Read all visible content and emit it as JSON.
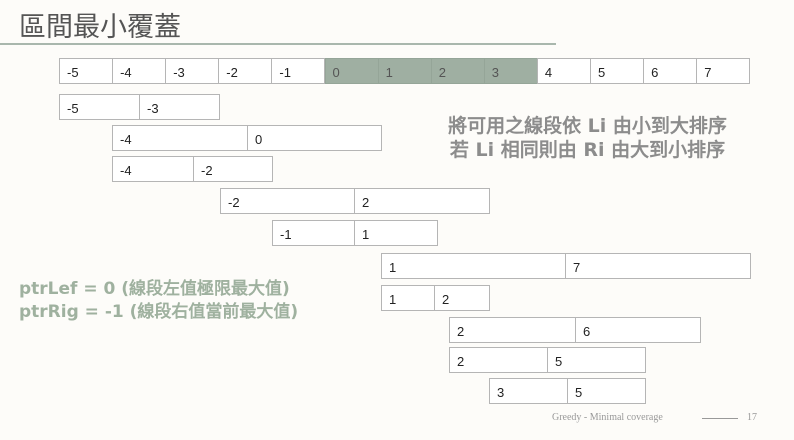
{
  "title": "區間最小覆蓋",
  "number_line": [
    "-5",
    "-4",
    "-3",
    "-2",
    "-1",
    "0",
    "1",
    "2",
    "3",
    "4",
    "5",
    "6",
    "7"
  ],
  "highlighted": [
    "0",
    "1",
    "2",
    "3"
  ],
  "segments": [
    {
      "l": "-5",
      "r": "-3"
    },
    {
      "l": "-4",
      "r": "0"
    },
    {
      "l": "-4",
      "r": "-2"
    },
    {
      "l": "-2",
      "r": "2"
    },
    {
      "l": "-1",
      "r": "1"
    },
    {
      "l": "1",
      "r": "7"
    },
    {
      "l": "1",
      "r": "2"
    },
    {
      "l": "2",
      "r": "6"
    },
    {
      "l": "2",
      "r": "5"
    },
    {
      "l": "3",
      "r": "5"
    }
  ],
  "note": {
    "line1": "將可用之線段依 Li 由小到大排序",
    "line2": "若 Li 相同則由 Ri 由大到小排序"
  },
  "pointers": {
    "left": "ptrLef = 0 (線段左值極限最大值)",
    "right": "ptrRig = -1 (線段右值當前最大值)"
  },
  "footer": {
    "text": "Greedy - Minimal coverage",
    "page": "17"
  },
  "colors": {
    "highlight": "#9fafa2",
    "accent_text": "#9fb19f"
  }
}
